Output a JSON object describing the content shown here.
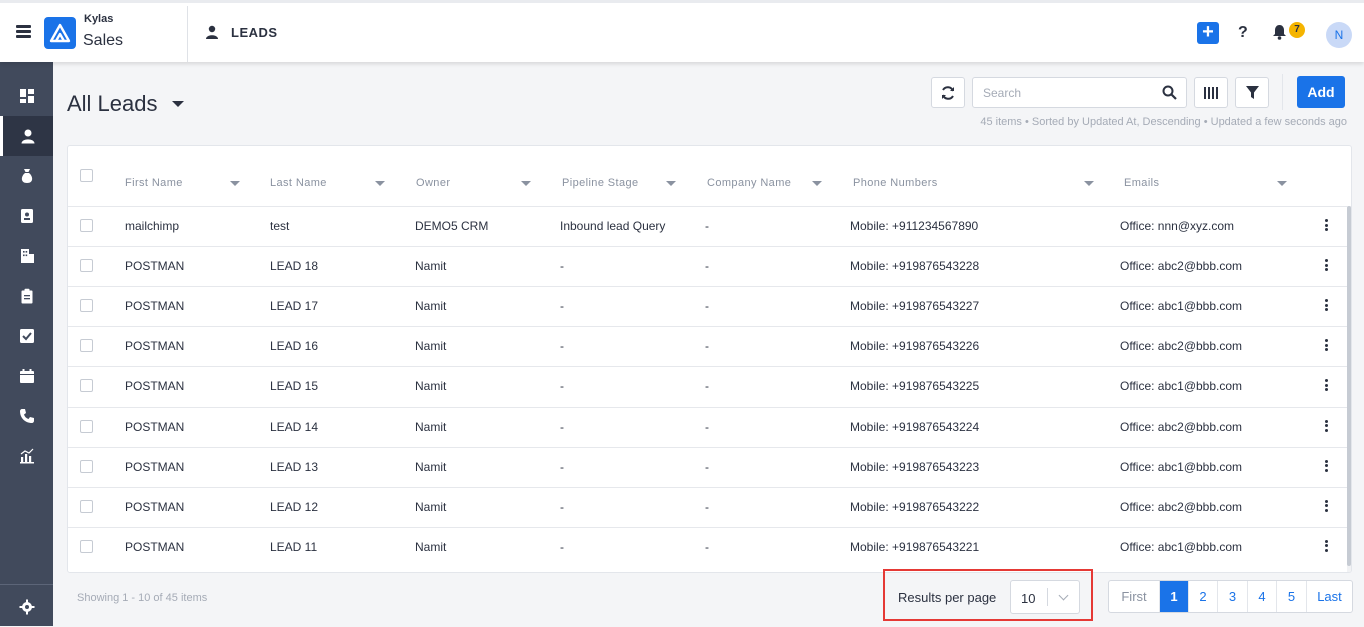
{
  "app": {
    "brand_top": "Kylas",
    "brand_bottom": "Sales",
    "module_title": "LEADS"
  },
  "header": {
    "notification_count": "7",
    "avatar_initial": "N",
    "accent": "#1a73e8"
  },
  "sidebar": {
    "items": [
      {
        "icon": "dashboard-icon"
      },
      {
        "icon": "user-icon",
        "active": true
      },
      {
        "icon": "money-bag-icon"
      },
      {
        "icon": "contact-card-icon"
      },
      {
        "icon": "building-icon"
      },
      {
        "icon": "clipboard-icon"
      },
      {
        "icon": "checkbox-icon"
      },
      {
        "icon": "calendar-icon"
      },
      {
        "icon": "phone-icon"
      },
      {
        "icon": "chart-icon"
      }
    ],
    "bottom_icon": "gear-icon"
  },
  "list": {
    "title": "All Leads",
    "search_placeholder": "Search",
    "add_label": "Add",
    "meta": "45 items • Sorted by Updated At, Descending • Updated a few seconds ago"
  },
  "table": {
    "columns": [
      "First Name",
      "Last Name",
      "Owner",
      "Pipeline Stage",
      "Company Name",
      "Phone Numbers",
      "Emails"
    ],
    "rows": [
      [
        "mailchimp",
        "test",
        "DEMO5 CRM",
        "Inbound lead Query",
        "-",
        "Mobile: +911234567890",
        "Office: nnn@xyz.com"
      ],
      [
        "POSTMAN",
        "LEAD 18",
        "Namit",
        "-",
        "-",
        "Mobile: +919876543228",
        "Office: abc2@bbb.com"
      ],
      [
        "POSTMAN",
        "LEAD 17",
        "Namit",
        "-",
        "-",
        "Mobile: +919876543227",
        "Office: abc1@bbb.com"
      ],
      [
        "POSTMAN",
        "LEAD 16",
        "Namit",
        "-",
        "-",
        "Mobile: +919876543226",
        "Office: abc2@bbb.com"
      ],
      [
        "POSTMAN",
        "LEAD 15",
        "Namit",
        "-",
        "-",
        "Mobile: +919876543225",
        "Office: abc1@bbb.com"
      ],
      [
        "POSTMAN",
        "LEAD 14",
        "Namit",
        "-",
        "-",
        "Mobile: +919876543224",
        "Office: abc2@bbb.com"
      ],
      [
        "POSTMAN",
        "LEAD 13",
        "Namit",
        "-",
        "-",
        "Mobile: +919876543223",
        "Office: abc1@bbb.com"
      ],
      [
        "POSTMAN",
        "LEAD 12",
        "Namit",
        "-",
        "-",
        "Mobile: +919876543222",
        "Office: abc2@bbb.com"
      ],
      [
        "POSTMAN",
        "LEAD 11",
        "Namit",
        "-",
        "-",
        "Mobile: +919876543221",
        "Office: abc1@bbb.com"
      ]
    ]
  },
  "footer": {
    "showing": "Showing 1 - 10 of 45 items",
    "results_per_page_label": "Results per page",
    "results_per_page_value": "10",
    "pages": [
      "First",
      "1",
      "2",
      "3",
      "4",
      "5",
      "Last"
    ],
    "current_page": "1"
  }
}
